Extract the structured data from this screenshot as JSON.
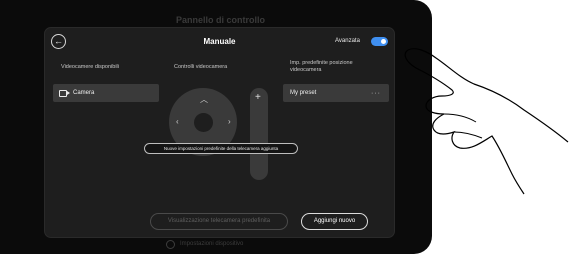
{
  "background": {
    "title": "Pannello di controllo",
    "settings_label": "Impostazioni dispositivo"
  },
  "panel": {
    "title": "Manuale",
    "advanced_label": "Avanzata",
    "advanced_enabled": true,
    "columns": {
      "available_cameras": "Videocamere disponibili",
      "camera_controls": "Controlli videocamera",
      "presets": "Imp. predefinite posizione videocamera"
    },
    "camera_item": "Camera",
    "preset_item": "My preset",
    "preset_menu": "···",
    "toast": "Nuove impostazioni predefinite della telecamera aggiunta",
    "zoom_plus": "+",
    "buttons": {
      "default_view": "Visualizzazione telecamera predefinita",
      "add_new": "Aggiungi nuovo"
    }
  },
  "colors": {
    "accent": "#3f8ff0",
    "panel_bg": "#1e1e1e",
    "item_bg": "#3a3a3a"
  }
}
